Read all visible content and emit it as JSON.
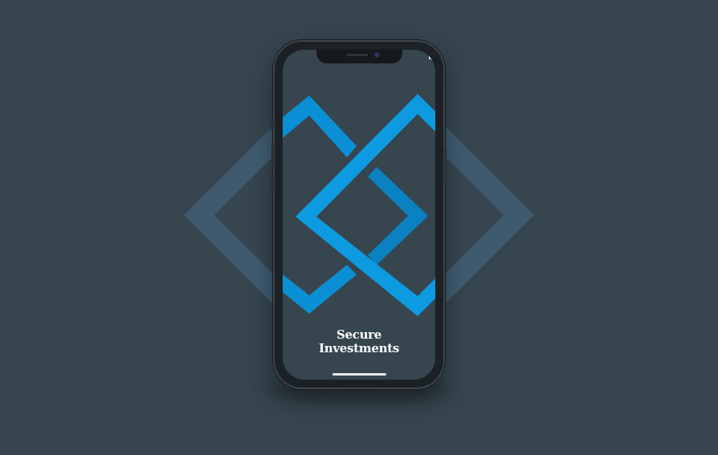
{
  "app": {
    "title_line1": "Secure",
    "title_line2": "Investments"
  },
  "status_bar": {
    "icons": [
      "cellular-signal-icon",
      "wifi-icon",
      "battery-icon"
    ]
  },
  "colors": {
    "background": "#36454e",
    "accent_blue": "#0d9ae0",
    "accent_blue_dark": "#0a82c1",
    "background_diamond": "#3f5a6f",
    "title_text": "#ffffff"
  }
}
